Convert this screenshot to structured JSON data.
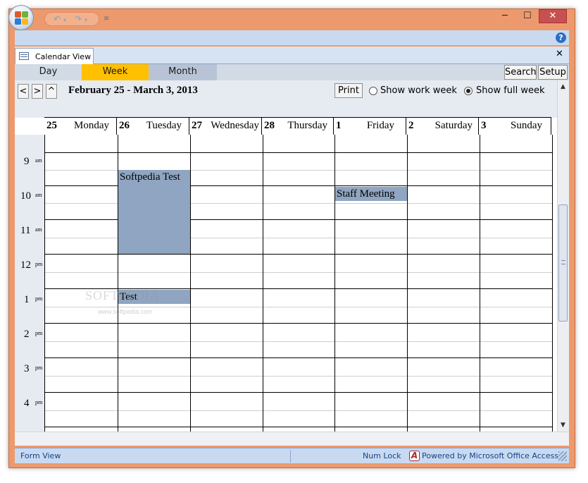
{
  "titlebar": {
    "minimize": "─",
    "maximize": "☐",
    "close": "✕"
  },
  "doc_tab": {
    "label": "Calendar View",
    "close": "✕"
  },
  "views": [
    {
      "label": "Day",
      "active": false
    },
    {
      "label": "Week",
      "active": true
    },
    {
      "label": "Month",
      "active": false
    }
  ],
  "buttons": {
    "search": "Search",
    "setup": "Setup",
    "prev": "<",
    "next": ">",
    "up": "^",
    "print": "Print"
  },
  "header": {
    "date_range": "February 25 - March 3, 2013"
  },
  "options": {
    "work_week": "Show work week",
    "full_week": "Show full week",
    "selected": "full_week"
  },
  "days": [
    {
      "num": "25",
      "name": "Monday"
    },
    {
      "num": "26",
      "name": "Tuesday"
    },
    {
      "num": "27",
      "name": "Wednesday"
    },
    {
      "num": "28",
      "name": "Thursday"
    },
    {
      "num": "1",
      "name": "Friday"
    },
    {
      "num": "2",
      "name": "Saturday"
    },
    {
      "num": "3",
      "name": "Sunday"
    }
  ],
  "hours": [
    {
      "hour": "9",
      "ampm": "am"
    },
    {
      "hour": "10",
      "ampm": "am"
    },
    {
      "hour": "11",
      "ampm": "am"
    },
    {
      "hour": "12",
      "ampm": "pm"
    },
    {
      "hour": "1",
      "ampm": "pm"
    },
    {
      "hour": "2",
      "ampm": "pm"
    },
    {
      "hour": "3",
      "ampm": "pm"
    },
    {
      "hour": "4",
      "ampm": "pm"
    }
  ],
  "events": [
    {
      "title": "Softpedia Test",
      "day": "26",
      "start": "9:30 am",
      "end": "12:00 pm"
    },
    {
      "title": "Staff Meeting",
      "day": "1",
      "start": "10:00 am",
      "end": "10:30 am"
    },
    {
      "title": "Test",
      "day": "26",
      "start": "1:00 pm",
      "end": "1:30 pm"
    }
  ],
  "watermark": {
    "text": "SOFTPEDIA",
    "url": "www.softpedia.com"
  },
  "status": {
    "form_view": "Form View",
    "num_lock": "Num Lock",
    "powered_by": "Powered by Microsoft Office Access"
  },
  "colors": {
    "frame": "#ec9a6d",
    "active_tab": "#ffc000",
    "event": "#8fa5c1",
    "status_text": "#15428b"
  }
}
